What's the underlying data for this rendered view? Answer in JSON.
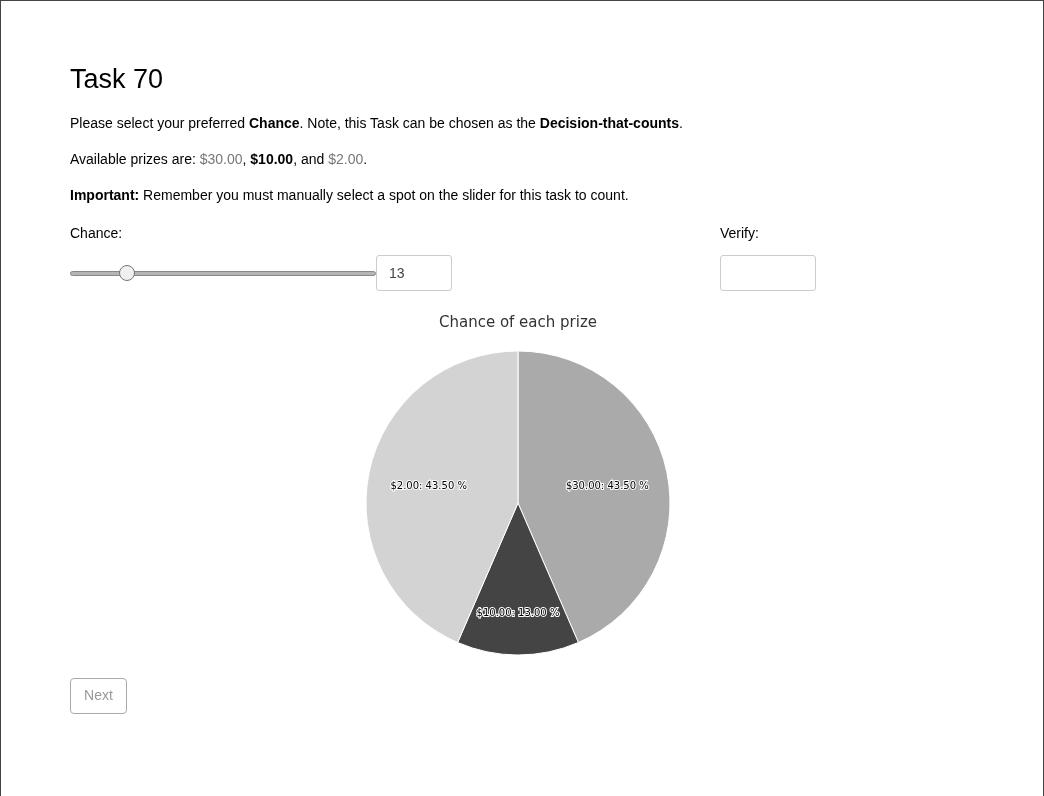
{
  "title": "Task 70",
  "instructions": "Please select your preferred **Chance**. Note, this Task can be chosen as the **Decision-that-counts**.",
  "prizes_line": [
    {
      "kind": "plain",
      "text": "Available prizes are: "
    },
    {
      "kind": "muted",
      "text": "$30.00"
    },
    {
      "kind": "plain",
      "text": ", "
    },
    {
      "kind": "bold",
      "text": "$10.00"
    },
    {
      "kind": "plain",
      "text": ", and "
    },
    {
      "kind": "muted",
      "text": "$2.00"
    },
    {
      "kind": "plain",
      "text": "."
    }
  ],
  "important": "**Important:** Remember you must manually select a spot on the slider for this task to count.",
  "chance": {
    "label": "Chance:",
    "level": 0.17,
    "value": "13"
  },
  "verify": {
    "label": "Verify:"
  },
  "chart": {
    "chart_data": {
      "type": "pie",
      "title": "Chance of each prize",
      "values": [
        43.5,
        13,
        43.5
      ],
      "colors": [
        "#aaaaaa",
        "#444444",
        "#d3d3d3"
      ],
      "value_labels": [
        "$30.00: 43.50 %",
        "$10.00: 13.00 %",
        "$2.00: 43.50 %"
      ]
    }
  },
  "next_button": {
    "label": "Next",
    "disabled": true
  }
}
